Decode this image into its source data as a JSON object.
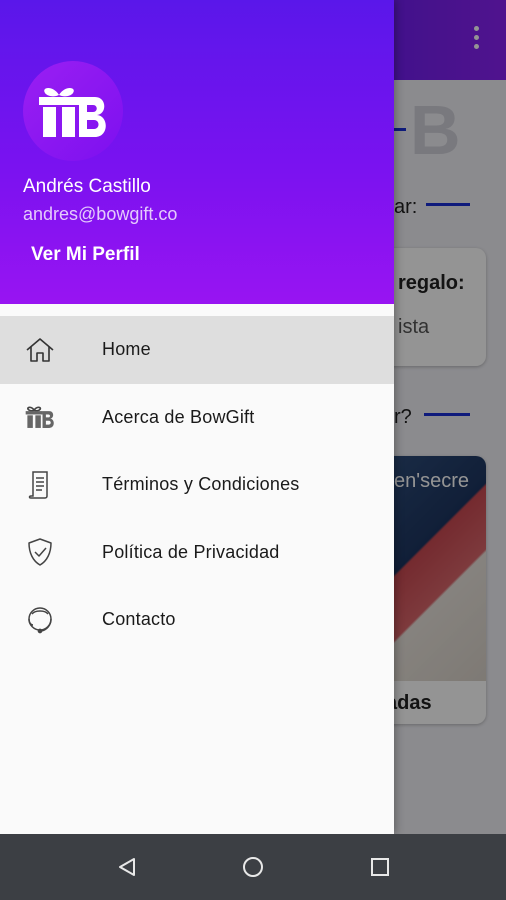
{
  "drawer": {
    "user_name": "Andrés Castillo",
    "user_email": "andres@bowgift.co",
    "profile_link": "Ver Mi Perfil",
    "items": [
      {
        "label": "Home",
        "icon": "home-icon",
        "active": true
      },
      {
        "label": "Acerca de BowGift",
        "icon": "bowgift-logo-icon",
        "active": false
      },
      {
        "label": "Términos y Condiciones",
        "icon": "document-icon",
        "active": false
      },
      {
        "label": "Política de Privacidad",
        "icon": "shield-check-icon",
        "active": false
      },
      {
        "label": "Contacto",
        "icon": "headset-icon",
        "active": false
      }
    ]
  },
  "background": {
    "partial_text_1": "ar:",
    "partial_text_2": "regalo:",
    "partial_text_3": "ista",
    "partial_text_4": "r?",
    "partial_text_5": "adas",
    "partial_text_6": "en'secre"
  },
  "navbar": {
    "back": "back-icon",
    "home": "home-circle-icon",
    "recents": "recents-icon"
  },
  "colors": {
    "header_top": "#5a17ea",
    "header_bottom": "#9814f2",
    "active_item_bg": "#dedede",
    "navbar_bg": "#3c3f44"
  }
}
